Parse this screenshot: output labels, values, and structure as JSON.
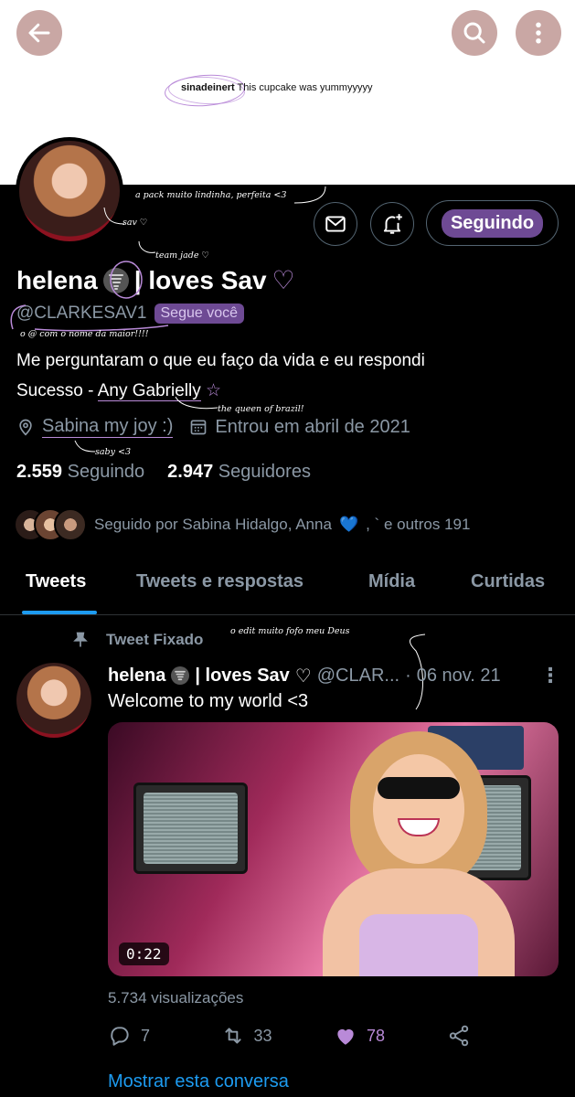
{
  "header": {
    "caption_user": "sinadeinert",
    "caption_text": "This cupcake was yummyyyyy"
  },
  "profile": {
    "display_name_1": "helena",
    "display_name_2": "| loves Sav",
    "heart": "♡",
    "handle": "@CLARKESAV1",
    "follows_you": "Segue você",
    "bio_line1": "Me perguntaram o que eu faço da vida e eu respondi",
    "bio_line2_prefix": "Sucesso - ",
    "bio_line2_name": "Any Gabrielly",
    "bio_line2_star": "☆",
    "location": "Sabina my joy :)",
    "joined": "Entrou em abril de 2021",
    "following_count": "2.559",
    "following_label": "Seguindo",
    "followers_count": "2.947",
    "followers_label": "Seguidores",
    "followed_by_prefix": "Seguido por Sabina Hidalgo, Anna",
    "followed_by_heart": "💙",
    "followed_by_suffix": ", ` e outros 191",
    "follow_button": "Seguindo"
  },
  "notes": {
    "pack": "a pack muito lindinha, perfeita <3",
    "sav": "sav ♡",
    "team_jade": "team jade ♡",
    "handle_note": "o @ com o nome da maior!!!!",
    "queen": "the queen of brazil!",
    "saby": "saby <3",
    "edit": "o edit muito fofo meu Deus"
  },
  "tabs": [
    {
      "label": "Tweets",
      "active": true
    },
    {
      "label": "Tweets e respostas",
      "active": false
    },
    {
      "label": "Mídia",
      "active": false
    },
    {
      "label": "Curtidas",
      "active": false
    }
  ],
  "tweet": {
    "pinned_label": "Tweet Fixado",
    "name_1": "helena",
    "name_2": "| loves Sav",
    "heart": "♡",
    "handle": "@CLAR...",
    "separator": "·",
    "date": "06 nov. 21",
    "more": "⋮",
    "text": "Welcome to my world <3",
    "video_time": "0:22",
    "views": "5.734 visualizações",
    "replies": "7",
    "retweets": "33",
    "likes": "78",
    "show_conversation": "Mostrar esta conversa"
  },
  "colors": {
    "accent_blue": "#1d9bf0",
    "purple_highlight": "#6e4a94",
    "like_purple": "#b98ad8",
    "header_button": "#c9a7a4"
  },
  "icons": [
    "back-arrow-icon",
    "search-icon",
    "more-vertical-icon",
    "mail-icon",
    "bell-plus-icon",
    "location-icon",
    "calendar-icon",
    "pin-icon",
    "reply-icon",
    "retweet-icon",
    "heart-icon",
    "share-icon"
  ]
}
